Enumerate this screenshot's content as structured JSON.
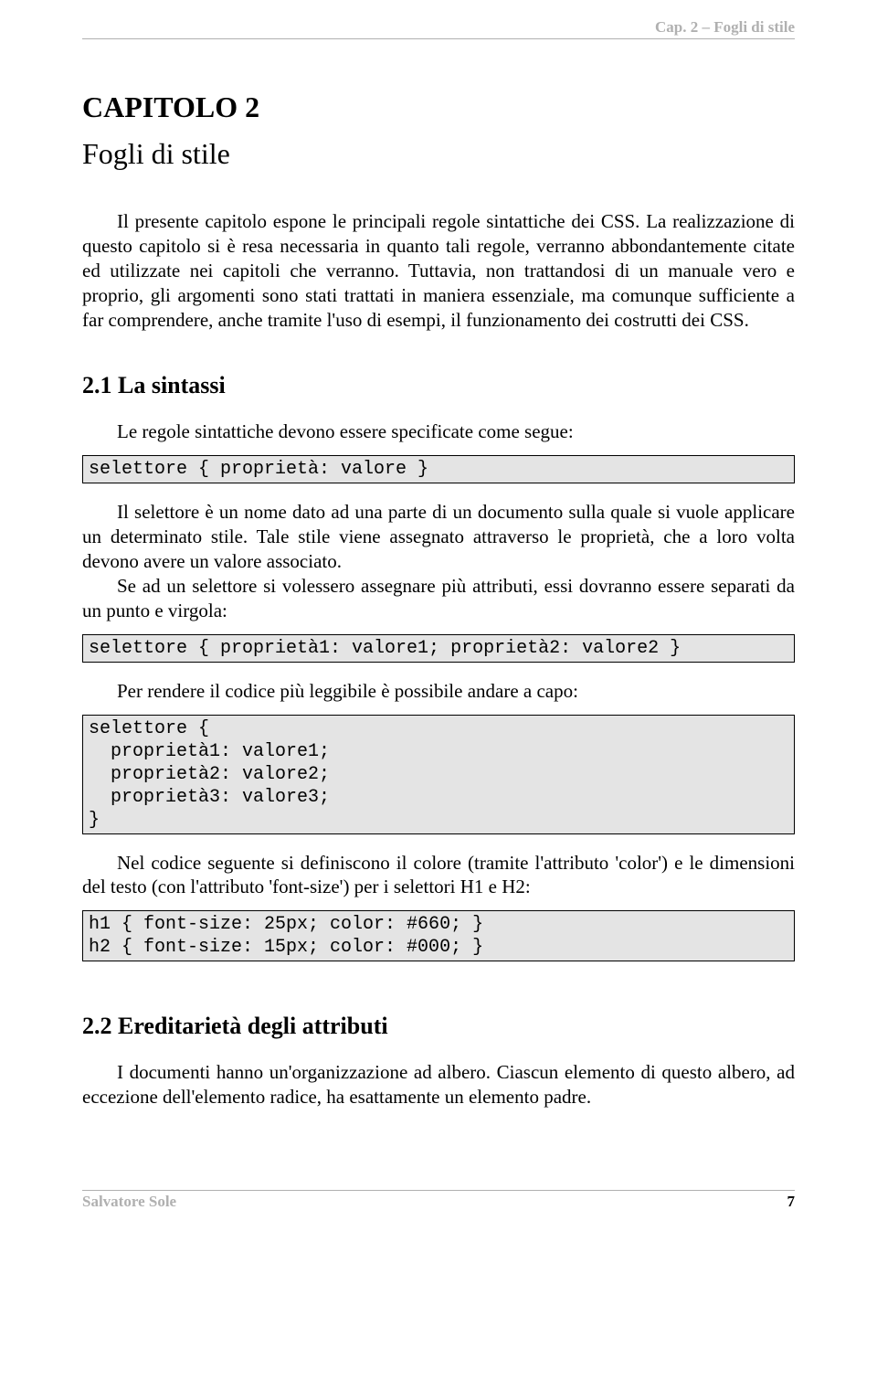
{
  "header": {
    "running_title": "Cap. 2 – Fogli di stile"
  },
  "chapter": {
    "number": "CAPITOLO 2",
    "title": "Fogli di stile"
  },
  "intro": "Il presente capitolo espone le principali regole sintattiche dei CSS. La realizzazione di questo capitolo si è resa necessaria in quanto tali regole, verranno abbondantemente citate ed utilizzate nei capitoli che verranno. Tuttavia, non trattandosi di un manuale vero e proprio, gli argomenti sono stati trattati in maniera essenziale, ma comunque sufficiente a far comprendere, anche tramite l'uso di esempi, il funzionamento dei costrutti dei CSS.",
  "section1": {
    "heading": "2.1  La sintassi",
    "p1": "Le regole sintattiche devono essere specificate come segue:",
    "code1": "selettore { proprietà: valore }",
    "p2a": "Il selettore è un nome dato ad una parte di un documento sulla quale si vuole applicare un determinato stile. Tale stile viene assegnato attraverso le proprietà, che a loro volta devono avere un valore associato.",
    "p2b": "Se ad un selettore si volessero assegnare più attributi, essi dovranno essere separati da un punto e virgola:",
    "code2": "selettore { proprietà1: valore1; proprietà2: valore2 }",
    "p3": "Per rendere il codice più leggibile è possibile andare a capo:",
    "code3": "selettore {\n  proprietà1: valore1;\n  proprietà2: valore2;\n  proprietà3: valore3;\n}",
    "p4": "Nel codice seguente si definiscono il colore (tramite l'attributo 'color')  e le dimensioni del testo (con l'attributo 'font-size') per i selettori H1 e H2:",
    "code4": "h1 { font-size: 25px; color: #660; }\nh2 { font-size: 15px; color: #000; }"
  },
  "section2": {
    "heading": "2.2  Ereditarietà degli attributi",
    "p1": "I documenti hanno un'organizzazione ad albero. Ciascun elemento di questo albero, ad eccezione dell'elemento radice, ha esattamente un elemento padre."
  },
  "footer": {
    "author": "Salvatore Sole",
    "page_number": "7"
  }
}
